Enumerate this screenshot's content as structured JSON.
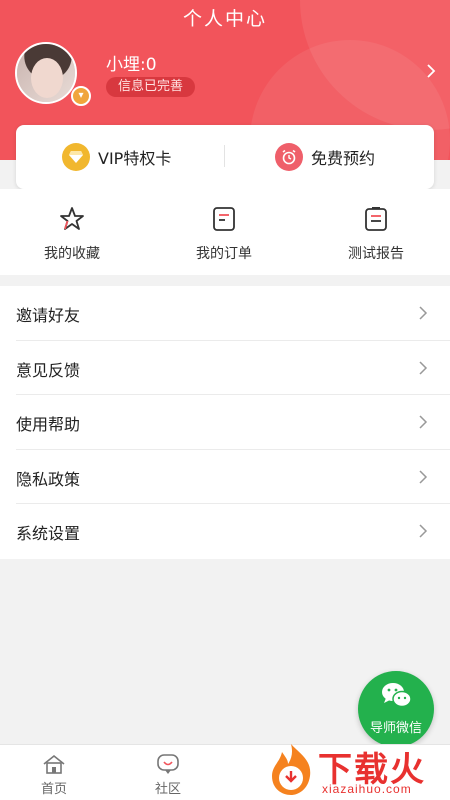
{
  "header": {
    "title": "个人中心",
    "username": "小埋:0",
    "info_status": "信息已完善"
  },
  "vip_card": {
    "vip_label": "VIP特权卡",
    "free_label": "免费预约"
  },
  "quick_links": [
    {
      "label": "我的收藏",
      "icon": "star-icon"
    },
    {
      "label": "我的订单",
      "icon": "order-icon"
    },
    {
      "label": "测试报告",
      "icon": "report-icon"
    }
  ],
  "menu": [
    {
      "label": "邀请好友"
    },
    {
      "label": "意见反馈"
    },
    {
      "label": "使用帮助"
    },
    {
      "label": "隐私政策"
    },
    {
      "label": "系统设置"
    }
  ],
  "floating": {
    "wechat_label": "导师微信"
  },
  "tabbar": [
    {
      "label": "首页",
      "icon": "home-icon"
    },
    {
      "label": "社区",
      "icon": "community-icon"
    }
  ],
  "watermark": {
    "text": "下载火",
    "sub": "xiazaihuo.com"
  },
  "colors": {
    "header_red": "#f2545b",
    "vip_gold": "#f1b72e",
    "wechat_green": "#23b14d"
  }
}
